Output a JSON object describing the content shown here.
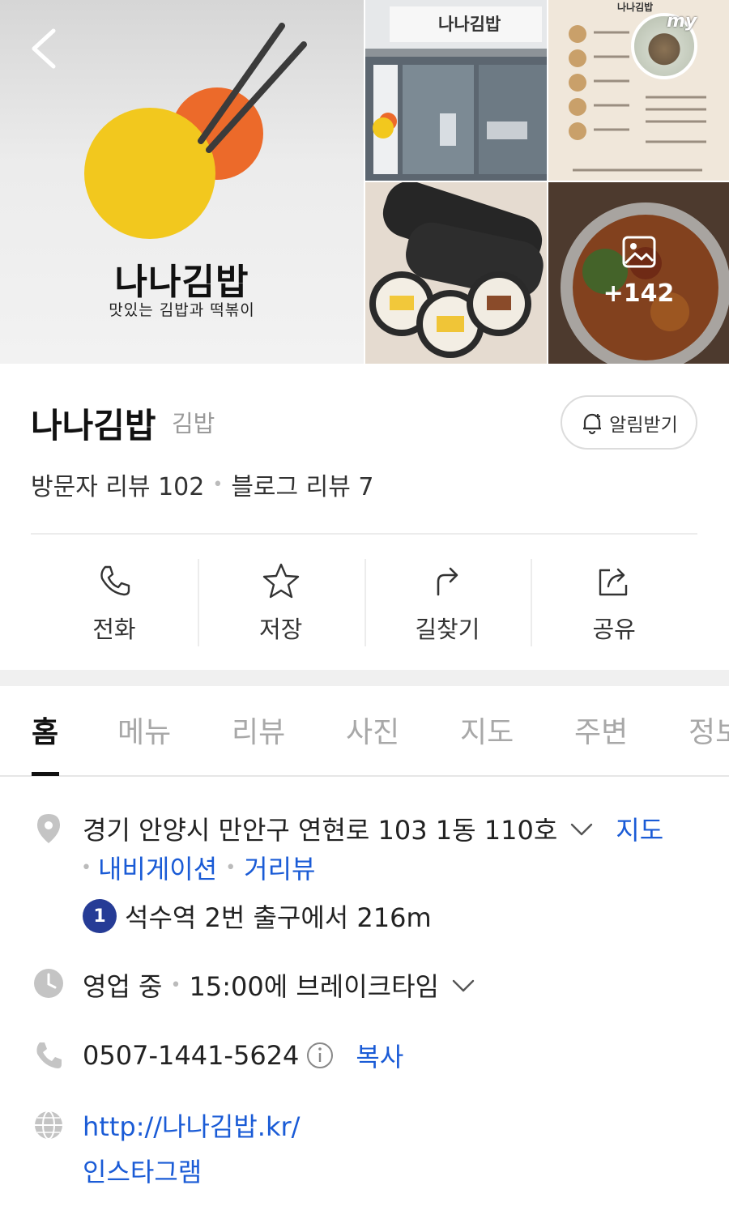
{
  "header": {
    "logo_name": "나나김밥",
    "logo_tagline": "맛있는 김밥과 떡볶이",
    "sign_text": "나나김밥",
    "menu_board_title": "나나김밥",
    "avatar_text": "my",
    "more_photos_count": "+142",
    "colors": {
      "sun_yellow": "#f2c81e",
      "sun_orange": "#ec6a2a",
      "chopsticks": "#3b3b3b"
    }
  },
  "place": {
    "name": "나나김밥",
    "category": "김밥",
    "notify_label": "알림받기",
    "visitor_reviews": "방문자 리뷰 102",
    "blog_reviews": "블로그 리뷰 7"
  },
  "actions": [
    {
      "label": "전화",
      "icon": "phone-icon"
    },
    {
      "label": "저장",
      "icon": "star-icon"
    },
    {
      "label": "길찾기",
      "icon": "directions-icon"
    },
    {
      "label": "공유",
      "icon": "share-icon"
    }
  ],
  "tabs": [
    "홈",
    "메뉴",
    "리뷰",
    "사진",
    "지도",
    "주변",
    "정보"
  ],
  "active_tab": "홈",
  "details": {
    "address": "경기 안양시 만안구 연현로 103 1동 110호",
    "map_link": "지도",
    "navigation_link": "내비게이션",
    "streetview_link": "거리뷰",
    "subway_line": "1",
    "subway_text": "석수역 2번 출구에서 216m",
    "status": "영업 중",
    "break_time": "15:00에 브레이크타임",
    "phone": "0507-1441-5624",
    "copy_label": "복사",
    "website": "http://나나김밥.kr/",
    "instagram": "인스타그램"
  },
  "theme": {
    "link_color": "#1a5bd6",
    "subway_line1_color": "#263c96"
  }
}
